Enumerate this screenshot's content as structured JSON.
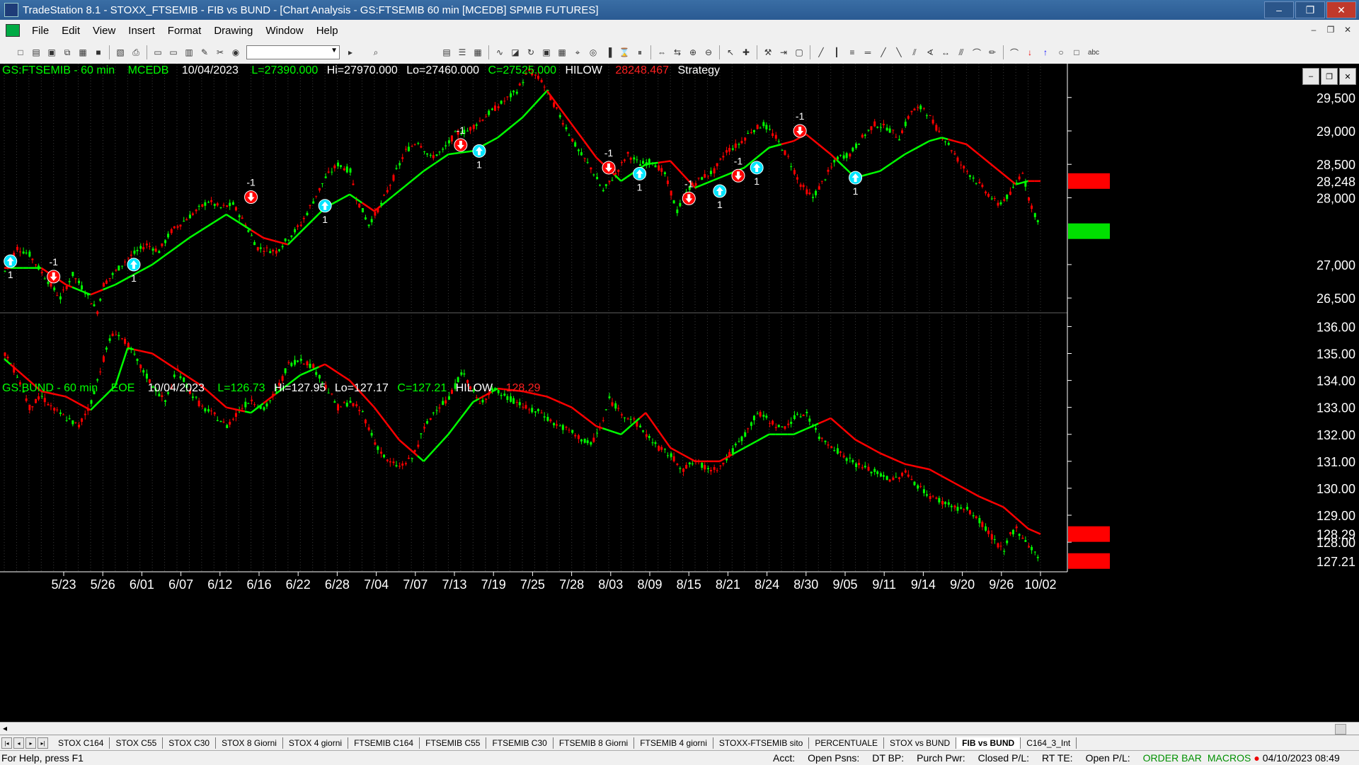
{
  "window": {
    "title": "TradeStation 8.1 - STOXX_FTSEMIB - FIB vs BUND - [Chart Analysis - GS:FTSEMIB  60 min  [MCEDB] SPMIB FUTURES]"
  },
  "menu": [
    "File",
    "Edit",
    "View",
    "Insert",
    "Format",
    "Drawing",
    "Window",
    "Help"
  ],
  "chart_data": [
    {
      "type": "candlestick",
      "symbol": "GS:FTSEMIB - 60 min",
      "exchange": "MCEDB",
      "date": "10/04/2023",
      "last": "L=27390.000",
      "high": "Hi=27970.000",
      "low": "Lo=27460.000",
      "close": "C=27525.000",
      "indicator": "HILOW",
      "indicator_value": "28248.467",
      "strategy": "Strategy",
      "y_ticks": [
        "29,500",
        "29,000",
        "28,500",
        "28,000",
        "27,000",
        "26,500"
      ],
      "y_tick_values": [
        29500,
        29000,
        28500,
        28000,
        27000,
        26500
      ],
      "ylim": [
        26300,
        29900
      ],
      "price_marker": "27,525",
      "hilow_marker": "28,248",
      "close_series": [
        [
          0,
          26900
        ],
        [
          2,
          27250
        ],
        [
          4,
          27150
        ],
        [
          7,
          26750
        ],
        [
          9,
          26500
        ],
        [
          11,
          26850
        ],
        [
          13,
          26600
        ],
        [
          15,
          26300
        ],
        [
          16,
          26700
        ],
        [
          18,
          26900
        ],
        [
          20,
          27100
        ],
        [
          23,
          27300
        ],
        [
          25,
          27200
        ],
        [
          27,
          27500
        ],
        [
          29,
          27650
        ],
        [
          31,
          27800
        ],
        [
          33,
          27950
        ],
        [
          35,
          27850
        ],
        [
          37,
          27900
        ],
        [
          39,
          27600
        ],
        [
          41,
          27250
        ],
        [
          44,
          27200
        ],
        [
          46,
          27400
        ],
        [
          48,
          27600
        ],
        [
          50,
          27950
        ],
        [
          52,
          28300
        ],
        [
          54,
          28500
        ],
        [
          56,
          28400
        ],
        [
          57,
          28000
        ],
        [
          59,
          27600
        ],
        [
          61,
          27900
        ],
        [
          63,
          28300
        ],
        [
          65,
          28700
        ],
        [
          67,
          28850
        ],
        [
          69,
          28600
        ],
        [
          71,
          28700
        ],
        [
          73,
          28950
        ],
        [
          75,
          29000
        ],
        [
          77,
          29150
        ],
        [
          79,
          29300
        ],
        [
          81,
          29450
        ],
        [
          83,
          29600
        ],
        [
          85,
          29900
        ],
        [
          87,
          29750
        ],
        [
          89,
          29400
        ],
        [
          91,
          29050
        ],
        [
          93,
          28700
        ],
        [
          95,
          28450
        ],
        [
          97,
          28100
        ],
        [
          99,
          28350
        ],
        [
          101,
          28650
        ],
        [
          103,
          28500
        ],
        [
          105,
          28550
        ],
        [
          107,
          28350
        ],
        [
          109,
          27800
        ],
        [
          111,
          28150
        ],
        [
          113,
          28300
        ],
        [
          115,
          28400
        ],
        [
          117,
          28700
        ],
        [
          119,
          28800
        ],
        [
          121,
          29000
        ],
        [
          123,
          29100
        ],
        [
          125,
          28900
        ],
        [
          127,
          28600
        ],
        [
          129,
          28200
        ],
        [
          131,
          28000
        ],
        [
          133,
          28300
        ],
        [
          135,
          28600
        ],
        [
          137,
          28650
        ],
        [
          139,
          28900
        ],
        [
          141,
          29100
        ],
        [
          143,
          29050
        ],
        [
          145,
          28900
        ],
        [
          147,
          29300
        ],
        [
          149,
          29350
        ],
        [
          151,
          29050
        ],
        [
          153,
          28800
        ],
        [
          155,
          28500
        ],
        [
          157,
          28300
        ],
        [
          159,
          28100
        ],
        [
          161,
          27900
        ],
        [
          163,
          28050
        ],
        [
          165,
          28400
        ],
        [
          166,
          28000
        ],
        [
          168,
          27500
        ]
      ],
      "hilow_series": [
        [
          0,
          26950
        ],
        [
          6,
          26950
        ],
        [
          10,
          26700
        ],
        [
          14,
          26550
        ],
        [
          18,
          26700
        ],
        [
          24,
          27000
        ],
        [
          30,
          27400
        ],
        [
          36,
          27750
        ],
        [
          42,
          27400
        ],
        [
          46,
          27300
        ],
        [
          52,
          27850
        ],
        [
          56,
          28050
        ],
        [
          60,
          27800
        ],
        [
          64,
          28100
        ],
        [
          68,
          28400
        ],
        [
          72,
          28650
        ],
        [
          76,
          28700
        ],
        [
          80,
          28900
        ],
        [
          84,
          29200
        ],
        [
          88,
          29600
        ],
        [
          92,
          29100
        ],
        [
          96,
          28600
        ],
        [
          100,
          28250
        ],
        [
          104,
          28500
        ],
        [
          108,
          28550
        ],
        [
          112,
          28150
        ],
        [
          116,
          28300
        ],
        [
          120,
          28450
        ],
        [
          124,
          28750
        ],
        [
          128,
          28850
        ],
        [
          130,
          28950
        ],
        [
          134,
          28650
        ],
        [
          138,
          28300
        ],
        [
          142,
          28400
        ],
        [
          146,
          28650
        ],
        [
          150,
          28850
        ],
        [
          152,
          28900
        ],
        [
          156,
          28800
        ],
        [
          160,
          28500
        ],
        [
          164,
          28200
        ],
        [
          166,
          28250
        ]
      ],
      "signals": [
        {
          "x": 1,
          "dir": "up",
          "label": "1",
          "price": 27050
        },
        {
          "x": 8,
          "dir": "down",
          "label": "-1",
          "price": 26820
        },
        {
          "x": 21,
          "dir": "up",
          "label": "1",
          "price": 27000
        },
        {
          "x": 40,
          "dir": "down",
          "label": "-1",
          "price": 28010
        },
        {
          "x": 52,
          "dir": "up",
          "label": "1",
          "price": 27880
        },
        {
          "x": 74,
          "dir": "down",
          "label": "-1",
          "price": 28790
        },
        {
          "x": 77,
          "dir": "up",
          "label": "1",
          "price": 28700
        },
        {
          "x": 98,
          "dir": "down",
          "label": "-1",
          "price": 28450
        },
        {
          "x": 103,
          "dir": "up",
          "label": "1",
          "price": 28360
        },
        {
          "x": 111,
          "dir": "down",
          "label": "-1",
          "price": 27990
        },
        {
          "x": 116,
          "dir": "up",
          "label": "1",
          "price": 28100
        },
        {
          "x": 119,
          "dir": "down",
          "label": "-1",
          "price": 28330
        },
        {
          "x": 122,
          "dir": "up",
          "label": "1",
          "price": 28450
        },
        {
          "x": 129,
          "dir": "down",
          "label": "-1",
          "price": 29000
        },
        {
          "x": 138,
          "dir": "up",
          "label": "1",
          "price": 28300
        }
      ]
    },
    {
      "type": "candlestick",
      "symbol": "GS:BUND - 60 min",
      "exchange": "EOE",
      "date": "10/04/2023",
      "last": "L=126.73",
      "high": "Hi=127.95",
      "low": "Lo=127.17",
      "close": "C=127.21",
      "indicator": "HILOW",
      "indicator_value": "128.29",
      "y_ticks": [
        "136.00",
        "135.00",
        "134.00",
        "133.00",
        "132.00",
        "131.00",
        "130.00",
        "129.00",
        "128.00"
      ],
      "y_tick_values": [
        136,
        135,
        134,
        133,
        132,
        131,
        130,
        129,
        128
      ],
      "ylim": [
        126.9,
        136.3
      ],
      "price_marker": "127.21",
      "hilow_marker": "128.29",
      "close_series": [
        [
          0,
          135.0
        ],
        [
          2,
          134.2
        ],
        [
          4,
          133.0
        ],
        [
          6,
          133.4
        ],
        [
          8,
          132.9
        ],
        [
          10,
          132.6
        ],
        [
          12,
          132.3
        ],
        [
          14,
          133.2
        ],
        [
          16,
          134.8
        ],
        [
          17,
          135.5
        ],
        [
          18,
          135.8
        ],
        [
          20,
          135.3
        ],
        [
          22,
          134.5
        ],
        [
          24,
          133.8
        ],
        [
          26,
          133.2
        ],
        [
          28,
          134.4
        ],
        [
          30,
          133.6
        ],
        [
          32,
          133.0
        ],
        [
          34,
          132.7
        ],
        [
          36,
          132.3
        ],
        [
          38,
          132.9
        ],
        [
          40,
          133.3
        ],
        [
          42,
          132.9
        ],
        [
          44,
          133.6
        ],
        [
          46,
          134.6
        ],
        [
          48,
          134.8
        ],
        [
          50,
          134.5
        ],
        [
          52,
          133.8
        ],
        [
          54,
          133.0
        ],
        [
          56,
          133.2
        ],
        [
          58,
          132.8
        ],
        [
          60,
          131.7
        ],
        [
          62,
          131.0
        ],
        [
          64,
          130.8
        ],
        [
          66,
          131.1
        ],
        [
          68,
          132.2
        ],
        [
          70,
          133.0
        ],
        [
          72,
          133.3
        ],
        [
          74,
          134.3
        ],
        [
          75,
          134.0
        ],
        [
          77,
          133.1
        ],
        [
          79,
          133.7
        ],
        [
          81,
          133.4
        ],
        [
          83,
          133.2
        ],
        [
          85,
          132.9
        ],
        [
          87,
          132.8
        ],
        [
          89,
          132.4
        ],
        [
          91,
          132.2
        ],
        [
          93,
          131.9
        ],
        [
          95,
          131.6
        ],
        [
          97,
          132.5
        ],
        [
          98,
          133.3
        ],
        [
          100,
          132.8
        ],
        [
          102,
          132.5
        ],
        [
          104,
          132.0
        ],
        [
          106,
          131.5
        ],
        [
          108,
          131.2
        ],
        [
          110,
          130.7
        ],
        [
          112,
          131.0
        ],
        [
          114,
          130.7
        ],
        [
          116,
          130.8
        ],
        [
          118,
          131.4
        ],
        [
          120,
          132.0
        ],
        [
          122,
          132.8
        ],
        [
          124,
          132.5
        ],
        [
          126,
          132.2
        ],
        [
          128,
          132.6
        ],
        [
          130,
          132.8
        ],
        [
          132,
          131.9
        ],
        [
          134,
          131.6
        ],
        [
          136,
          131.2
        ],
        [
          138,
          130.9
        ],
        [
          140,
          130.7
        ],
        [
          142,
          130.5
        ],
        [
          144,
          130.3
        ],
        [
          146,
          130.6
        ],
        [
          148,
          130.1
        ],
        [
          150,
          129.7
        ],
        [
          152,
          129.5
        ],
        [
          154,
          129.3
        ],
        [
          156,
          129.2
        ],
        [
          158,
          128.8
        ],
        [
          160,
          128.2
        ],
        [
          162,
          127.6
        ],
        [
          163,
          128.3
        ],
        [
          164,
          128.5
        ],
        [
          166,
          127.9
        ],
        [
          168,
          127.3
        ]
      ],
      "hilow_series": [
        [
          0,
          134.8
        ],
        [
          6,
          133.6
        ],
        [
          10,
          133.4
        ],
        [
          14,
          132.9
        ],
        [
          18,
          133.8
        ],
        [
          20,
          135.2
        ],
        [
          24,
          135.0
        ],
        [
          28,
          134.4
        ],
        [
          32,
          133.8
        ],
        [
          36,
          133.0
        ],
        [
          40,
          132.8
        ],
        [
          44,
          133.5
        ],
        [
          48,
          134.2
        ],
        [
          52,
          134.6
        ],
        [
          56,
          134.0
        ],
        [
          60,
          133.0
        ],
        [
          64,
          131.8
        ],
        [
          68,
          131.0
        ],
        [
          72,
          132.0
        ],
        [
          76,
          133.2
        ],
        [
          80,
          133.7
        ],
        [
          84,
          133.6
        ],
        [
          88,
          133.4
        ],
        [
          92,
          133.0
        ],
        [
          96,
          132.3
        ],
        [
          100,
          132.0
        ],
        [
          104,
          132.8
        ],
        [
          108,
          131.5
        ],
        [
          112,
          131.0
        ],
        [
          116,
          131.0
        ],
        [
          120,
          131.5
        ],
        [
          124,
          132.0
        ],
        [
          128,
          132.0
        ],
        [
          130,
          132.2
        ],
        [
          134,
          132.6
        ],
        [
          138,
          131.8
        ],
        [
          142,
          131.3
        ],
        [
          146,
          130.9
        ],
        [
          150,
          130.7
        ],
        [
          154,
          130.2
        ],
        [
          158,
          129.7
        ],
        [
          162,
          129.3
        ],
        [
          166,
          128.5
        ],
        [
          168,
          128.3
        ]
      ]
    }
  ],
  "x_axis": {
    "labels": [
      "5/23",
      "5/26",
      "6/01",
      "6/07",
      "6/12",
      "6/16",
      "6/22",
      "6/28",
      "7/04",
      "7/07",
      "7/13",
      "7/19",
      "7/25",
      "7/28",
      "8/03",
      "8/09",
      "8/15",
      "8/21",
      "8/24",
      "8/30",
      "9/05",
      "9/11",
      "9/14",
      "9/20",
      "9/26",
      "10/02"
    ]
  },
  "tabs": [
    "STOX C164",
    "STOX C55",
    "STOX  C30",
    "STOX  8 Giorni",
    "STOX 4 giorni",
    "FTSEMIB C164",
    "FTSEMIB C55",
    "FTSEMIB C30",
    "FTSEMIB  8 Giorni",
    "FTSEMIB  4 giorni",
    "STOXX-FTSEMIB sito",
    "PERCENTUALE",
    "STOX vs BUND",
    "FIB vs BUND",
    "C164_3_Int"
  ],
  "active_tab": "FIB vs BUND",
  "status": {
    "help": "For Help, press F1",
    "fields": [
      "Acct:",
      "Open Psns:",
      "DT BP:",
      "Purch Pwr:",
      "Closed P/L:",
      "RT TE:",
      "Open P/L:"
    ],
    "order_bar": "ORDER BAR",
    "macros": "MACROS",
    "datetime": "04/10/2023 08:49"
  },
  "colors": {
    "up_bar": "#00ff00",
    "down_bar": "#ff0000",
    "hilow_up": "#00ff00",
    "hilow_down": "#ff0000",
    "signal_up": "#00e5ff",
    "signal_down": "#ff0000",
    "background": "#000000",
    "last_price_bg": "#00e000",
    "hilow_bg": "#ff0000"
  }
}
